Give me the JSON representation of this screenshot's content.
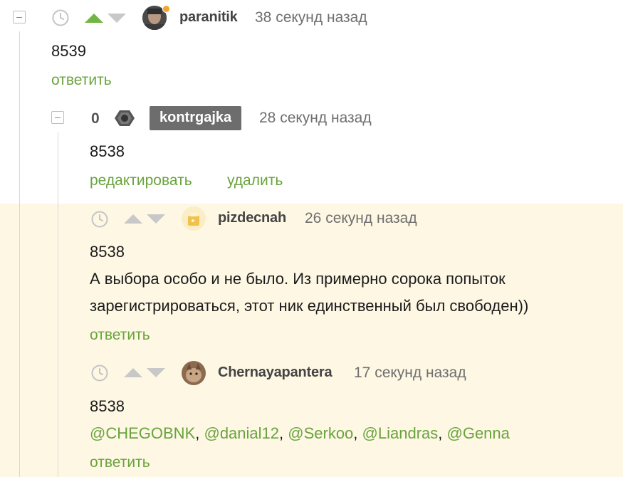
{
  "comments": [
    {
      "username": "paranitik",
      "time": "38 секунд назад",
      "text": "8539",
      "reply_label": "ответить"
    },
    {
      "score": "0",
      "username": "kontrgajka",
      "time": "28 секунд назад",
      "text": "8538",
      "edit_label": "редактировать",
      "delete_label": "удалить"
    },
    {
      "username": "pizdecnah",
      "time": "26 секунд назад",
      "text_line1": "8538",
      "text_line2": "А выбора особо и не было. Из примерно сорока попыток",
      "text_line3": "зарегистрироваться, этот ник единственный был свободен))",
      "reply_label": "ответить"
    },
    {
      "username": "Chernayapantera",
      "time": "17 секунд назад",
      "text_line1": "8538",
      "mentions": [
        "@CHEGOBNK",
        "@danial12",
        "@Serkoo",
        "@Liandras",
        "@Genna"
      ],
      "reply_label": "ответить"
    }
  ],
  "colors": {
    "accent_green": "#6aa33e",
    "highlight_bg": "#fdf7e4",
    "badge_bg": "#6d6d6d",
    "online_dot": "#f4a52c"
  },
  "icons": [
    "collapse-icon",
    "clock-icon",
    "upvote-icon",
    "downvote-icon",
    "avatar"
  ]
}
